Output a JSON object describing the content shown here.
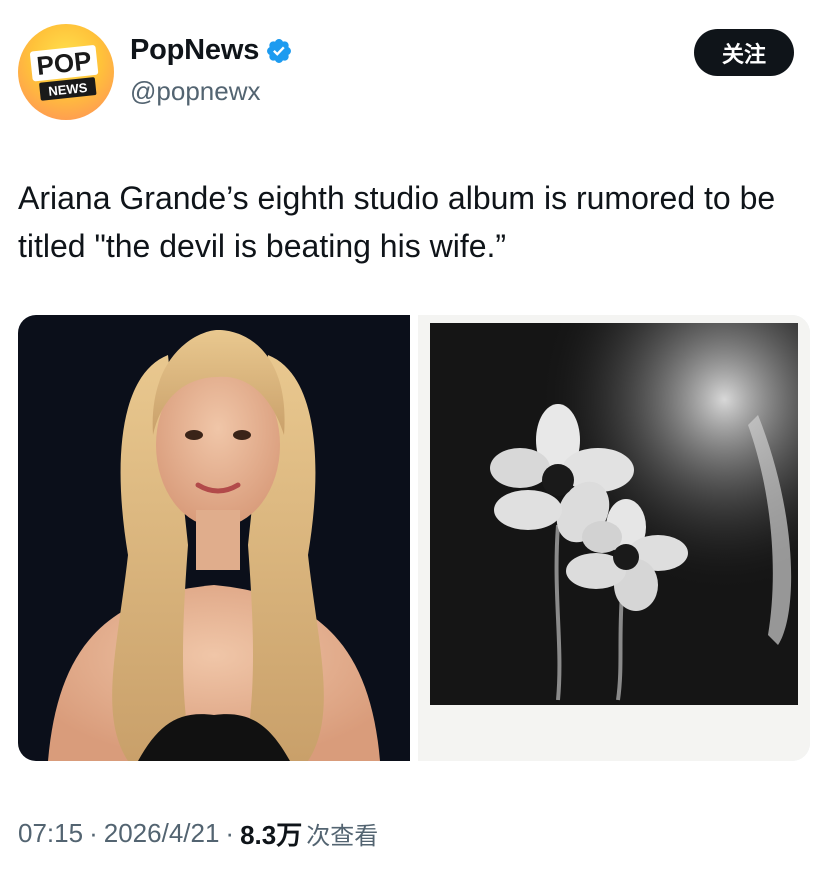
{
  "account": {
    "display_name": "PopNews",
    "handle": "@popnewx",
    "avatar_text_top": "POP",
    "avatar_text_bottom": "NEWS",
    "verified": true
  },
  "follow_button": {
    "label": "关注"
  },
  "tweet": {
    "text": "Ariana Grande’s eighth studio album is rumored to be titled \"the devil is beating his wife.”"
  },
  "media": [
    {
      "icon": "portrait-photo",
      "description": ""
    },
    {
      "icon": "flower-polaroid-photo",
      "description": ""
    }
  ],
  "meta": {
    "time": "07:15",
    "separator": "·",
    "date": "2026/4/21",
    "views": "8.3万",
    "views_suffix": "次查看"
  },
  "colors": {
    "text_primary": "#0f1419",
    "text_secondary": "#536471",
    "verified_blue": "#1d9bf0",
    "button_bg": "#0f1419"
  }
}
